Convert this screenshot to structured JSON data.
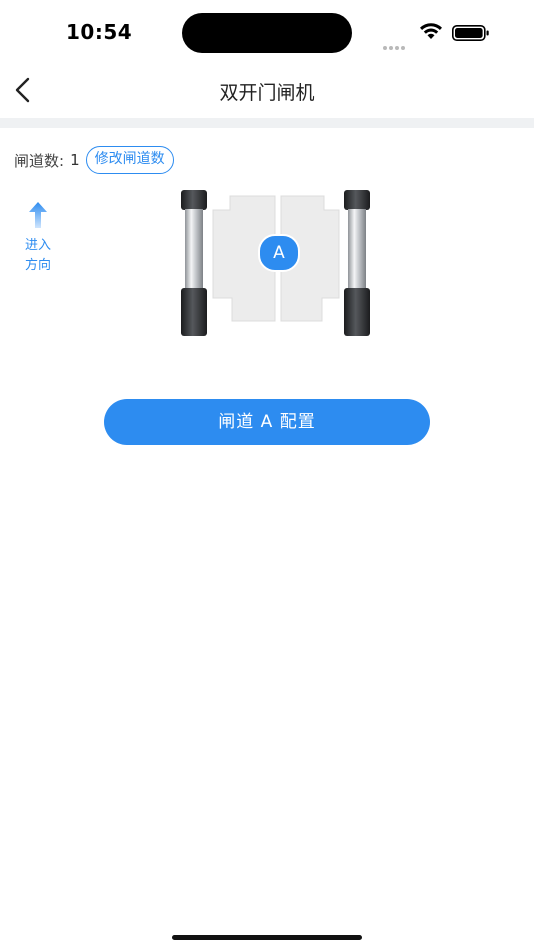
{
  "status_bar": {
    "time": "10:54",
    "icons": [
      "signal-dots-icon",
      "wifi-icon",
      "battery-icon"
    ]
  },
  "nav": {
    "back_icon": "chevron-left-icon",
    "title": "双开门闸机"
  },
  "lanes": {
    "label": "闸道数:",
    "count": "1",
    "edit_button": "修改闸道数"
  },
  "direction": {
    "icon": "arrow-up-icon",
    "text": "进入方向"
  },
  "gate": {
    "lane_name": "A"
  },
  "actions": {
    "config_button": "闸道 A 配置"
  },
  "colors": {
    "accent": "#2d8cf0",
    "divider": "#eff1f3",
    "text": "#333333"
  }
}
